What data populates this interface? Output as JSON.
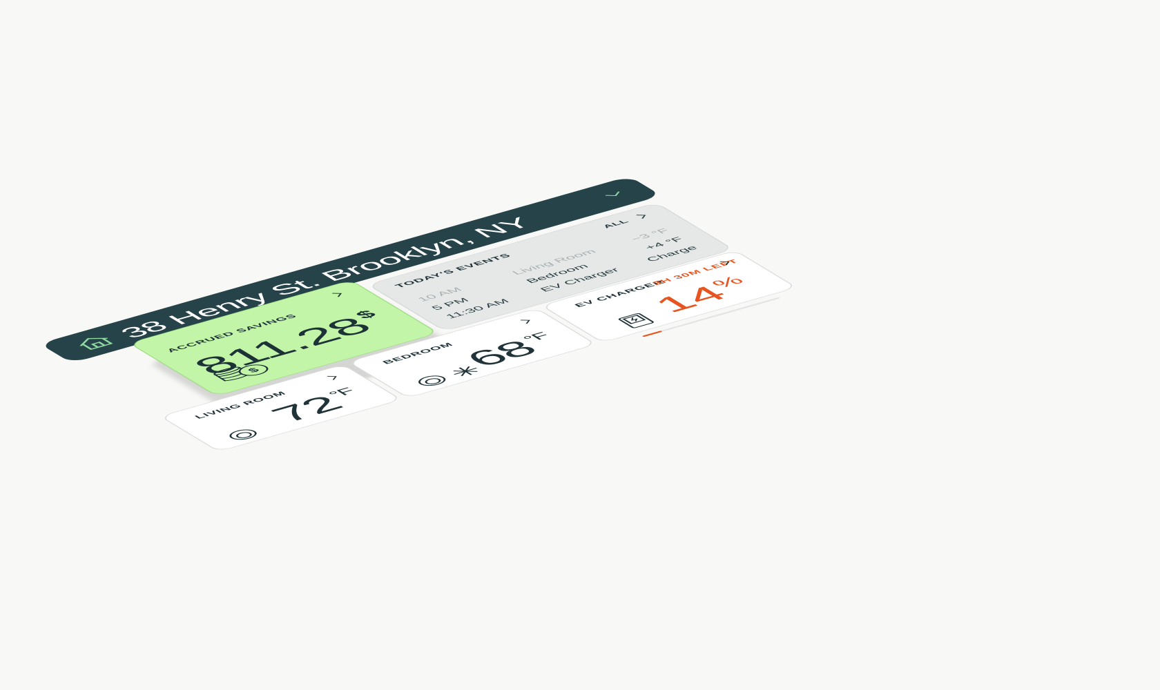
{
  "colors": {
    "header_bg": "#26434a",
    "savings_bg": "#c3f5a8",
    "accent_orange": "#e8541f",
    "events_bg": "#e6e8e8"
  },
  "header": {
    "address": "38 Henry St. Brooklyn, NY",
    "home_icon": "home-icon",
    "dropdown_icon": "chevron-down-icon"
  },
  "savings": {
    "label": "ACCRUED SAVINGS",
    "amount": "811.28",
    "currency": "$",
    "icon": "coins-dollar-icon"
  },
  "events": {
    "label": "TODAY'S EVENTS",
    "all_link": "ALL",
    "items": [
      {
        "time": "10 AM",
        "place": "Living Room",
        "change": "−3 °F"
      },
      {
        "time": "5 PM",
        "place": "Bedroom",
        "change": "+4 °F"
      },
      {
        "time": "11:30 AM",
        "place": "EV Charger",
        "change": "Charge"
      }
    ]
  },
  "ev_charger": {
    "label": "EV CHARGER",
    "time_left": "3H 30M LEFT",
    "percent": "14",
    "percent_unit": "%",
    "progress": 0.14,
    "icon": "ev-charger-icon"
  },
  "bedroom": {
    "label": "BEDROOM",
    "temp": "68",
    "unit": "°F",
    "icons": [
      "thermostat-dial-icon",
      "snowflake-icon"
    ]
  },
  "living_room": {
    "label": "LIVING ROOM",
    "temp": "72",
    "unit": "°F",
    "icon": "thermostat-dial-icon"
  }
}
